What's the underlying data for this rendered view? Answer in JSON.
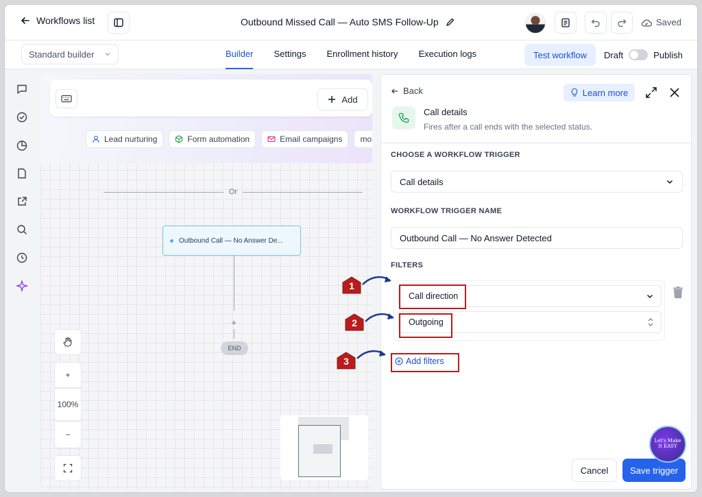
{
  "header": {
    "back_label": "Workflows list",
    "workflow_title": "Outbound Missed Call — Auto SMS Follow-Up",
    "saved_label": "Saved"
  },
  "navbar": {
    "builder_select": "Standard builder",
    "tabs": [
      {
        "label": "Builder",
        "active": true
      },
      {
        "label": "Settings",
        "active": false
      },
      {
        "label": "Enrollment history",
        "active": false
      },
      {
        "label": "Execution logs",
        "active": false
      }
    ],
    "test_workflow": "Test workflow",
    "draft_label": "Draft",
    "publish_label": "Publish"
  },
  "sidebar": {
    "icons": [
      "chat-icon",
      "check-circle-icon",
      "pie-chart-icon",
      "document-icon",
      "external-link-icon",
      "search-icon",
      "history-icon",
      "sparkle-icon"
    ]
  },
  "canvas": {
    "add_label": "Add",
    "chips": [
      {
        "label": "Lead nurturing",
        "icon": "user-icon",
        "color": "#2563eb"
      },
      {
        "label": "Form automation",
        "icon": "cube-icon",
        "color": "#16a34a"
      },
      {
        "label": "Email campaigns",
        "icon": "mail-icon",
        "color": "#db2777"
      },
      {
        "label": "mo",
        "icon": "",
        "color": "#374151"
      }
    ],
    "or_label": "Or",
    "trigger_node": "Outbound Call — No Answer De...",
    "plus_label": "+",
    "end_label": "END",
    "zoom": {
      "in": "+",
      "level": "100%",
      "out": "−"
    }
  },
  "panel": {
    "back_label": "Back",
    "learn_more": "Learn more",
    "title": "Call details",
    "subtitle": "Fires after a call ends with the selected status.",
    "choose_trigger_label": "CHOOSE A WORKFLOW TRIGGER",
    "trigger_value": "Call details",
    "trigger_name_label": "WORKFLOW TRIGGER NAME",
    "trigger_name_value": "Outbound Call — No Answer Detected",
    "filters_label": "FILTERS",
    "filter_field": "Call direction",
    "filter_value": "Outgoing",
    "add_filters": "Add filters",
    "cancel": "Cancel",
    "save": "Save trigger"
  },
  "annotations": {
    "step1": "1",
    "step2": "2",
    "step3": "3",
    "highlight_color": "#b91c1c"
  },
  "watermark": "Let's Make It EASY"
}
